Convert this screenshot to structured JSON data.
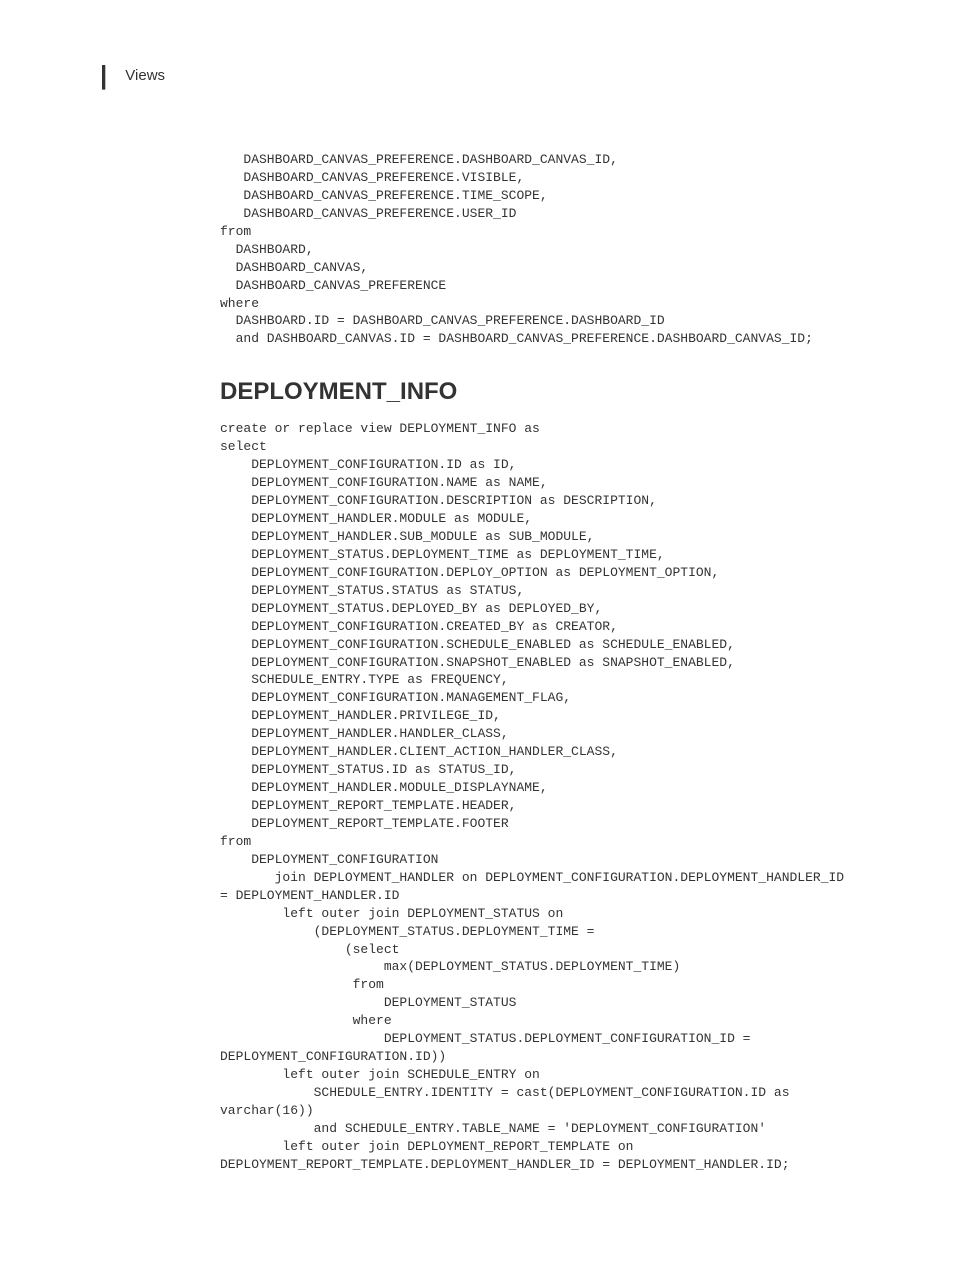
{
  "header": {
    "divider": "|",
    "title": "Views"
  },
  "code_block_1": "   DASHBOARD_CANVAS_PREFERENCE.DASHBOARD_CANVAS_ID,\n   DASHBOARD_CANVAS_PREFERENCE.VISIBLE,\n   DASHBOARD_CANVAS_PREFERENCE.TIME_SCOPE,\n   DASHBOARD_CANVAS_PREFERENCE.USER_ID\nfrom\n  DASHBOARD,\n  DASHBOARD_CANVAS,\n  DASHBOARD_CANVAS_PREFERENCE\nwhere\n  DASHBOARD.ID = DASHBOARD_CANVAS_PREFERENCE.DASHBOARD_ID\n  and DASHBOARD_CANVAS.ID = DASHBOARD_CANVAS_PREFERENCE.DASHBOARD_CANVAS_ID;",
  "section_heading": "DEPLOYMENT_INFO",
  "code_block_2": "create or replace view DEPLOYMENT_INFO as\nselect\n    DEPLOYMENT_CONFIGURATION.ID as ID,\n    DEPLOYMENT_CONFIGURATION.NAME as NAME,\n    DEPLOYMENT_CONFIGURATION.DESCRIPTION as DESCRIPTION,\n    DEPLOYMENT_HANDLER.MODULE as MODULE,\n    DEPLOYMENT_HANDLER.SUB_MODULE as SUB_MODULE,\n    DEPLOYMENT_STATUS.DEPLOYMENT_TIME as DEPLOYMENT_TIME,\n    DEPLOYMENT_CONFIGURATION.DEPLOY_OPTION as DEPLOYMENT_OPTION,\n    DEPLOYMENT_STATUS.STATUS as STATUS,\n    DEPLOYMENT_STATUS.DEPLOYED_BY as DEPLOYED_BY,\n    DEPLOYMENT_CONFIGURATION.CREATED_BY as CREATOR,\n    DEPLOYMENT_CONFIGURATION.SCHEDULE_ENABLED as SCHEDULE_ENABLED,\n    DEPLOYMENT_CONFIGURATION.SNAPSHOT_ENABLED as SNAPSHOT_ENABLED,\n    SCHEDULE_ENTRY.TYPE as FREQUENCY,\n    DEPLOYMENT_CONFIGURATION.MANAGEMENT_FLAG,\n    DEPLOYMENT_HANDLER.PRIVILEGE_ID,\n    DEPLOYMENT_HANDLER.HANDLER_CLASS,\n    DEPLOYMENT_HANDLER.CLIENT_ACTION_HANDLER_CLASS,\n    DEPLOYMENT_STATUS.ID as STATUS_ID,\n    DEPLOYMENT_HANDLER.MODULE_DISPLAYNAME,\n    DEPLOYMENT_REPORT_TEMPLATE.HEADER,\n    DEPLOYMENT_REPORT_TEMPLATE.FOOTER\nfrom\n    DEPLOYMENT_CONFIGURATION\n       join DEPLOYMENT_HANDLER on DEPLOYMENT_CONFIGURATION.DEPLOYMENT_HANDLER_ID\n= DEPLOYMENT_HANDLER.ID\n        left outer join DEPLOYMENT_STATUS on\n            (DEPLOYMENT_STATUS.DEPLOYMENT_TIME =\n                (select\n                     max(DEPLOYMENT_STATUS.DEPLOYMENT_TIME)\n                 from\n                     DEPLOYMENT_STATUS\n                 where\n                     DEPLOYMENT_STATUS.DEPLOYMENT_CONFIGURATION_ID =\nDEPLOYMENT_CONFIGURATION.ID))\n        left outer join SCHEDULE_ENTRY on\n            SCHEDULE_ENTRY.IDENTITY = cast(DEPLOYMENT_CONFIGURATION.ID as\nvarchar(16))\n            and SCHEDULE_ENTRY.TABLE_NAME = 'DEPLOYMENT_CONFIGURATION'\n        left outer join DEPLOYMENT_REPORT_TEMPLATE on\nDEPLOYMENT_REPORT_TEMPLATE.DEPLOYMENT_HANDLER_ID = DEPLOYMENT_HANDLER.ID;"
}
